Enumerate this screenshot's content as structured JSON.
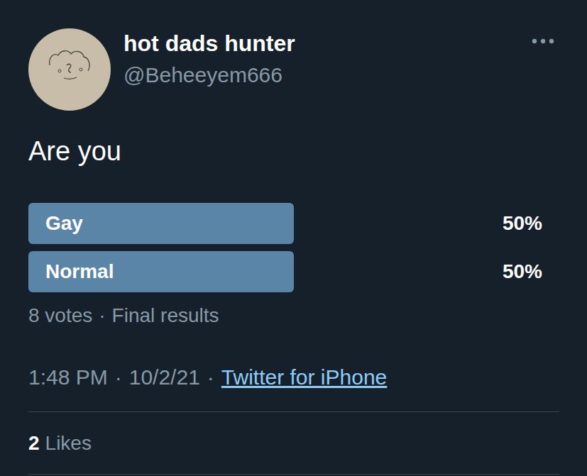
{
  "user": {
    "name": "hot dads hunter",
    "handle": "@Beheeyem666"
  },
  "tweet": {
    "text": "Are you"
  },
  "poll": {
    "options": [
      {
        "label": "Gay",
        "percent": "50%",
        "level": 0.5
      },
      {
        "label": "Normal",
        "percent": "50%",
        "level": 0.5
      }
    ],
    "votes": "8 votes",
    "separator": "·",
    "status": "Final results"
  },
  "meta": {
    "time": "1:48 PM",
    "separator": "·",
    "date": "10/2/21",
    "source": "Twitter for iPhone"
  },
  "likes": {
    "count": "2",
    "label": "Likes"
  }
}
